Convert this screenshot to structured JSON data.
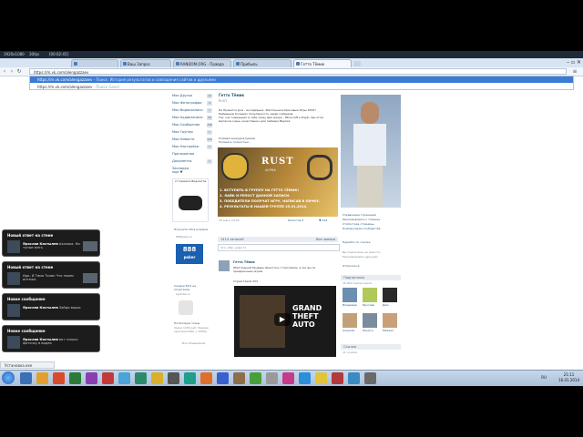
{
  "recording_bar": {
    "items": [
      "1920x1080",
      "30fps",
      "[00:02:45]"
    ]
  },
  "browser": {
    "tabs": [
      {
        "label": ""
      },
      {
        "label": "Ваш Запрос"
      },
      {
        "label": "RANDOM.ORG - Правда"
      },
      {
        "label": "Прибыль"
      },
      {
        "label": "Гетто Тёмик"
      }
    ],
    "address": "https://m.vk.com/alengazzaev",
    "suggestions": [
      {
        "url": "https://m.vk.com/alengazzaev",
        "desc": "- Поиск. История результатов и совпадения сайтов и друзьями"
      },
      {
        "url": "https://m.vk.com/alengazzaev",
        "desc": "- Поиск Gavel"
      }
    ]
  },
  "left_menu": {
    "items": [
      {
        "label": "Мои Друзья",
        "count": "12"
      },
      {
        "label": "Мои Фотографии",
        "count": "4"
      },
      {
        "label": "Мои Видеозаписи",
        "count": "1"
      },
      {
        "label": "Мои Аудиозаписи",
        "count": "35"
      },
      {
        "label": "Мои Сообщения",
        "count": "158"
      },
      {
        "label": "Мои Группы",
        "count": "1"
      },
      {
        "label": "Мои Новости",
        "count": "144"
      },
      {
        "label": "Мои Настройки",
        "count": "1"
      },
      {
        "label": "Приложения",
        "count": ""
      },
      {
        "label": "Документы",
        "count": "1"
      },
      {
        "label": "Закладки",
        "count": ""
      }
    ],
    "extra": "ещё ♥",
    "ad1": {
      "title": "от Сервиса Виджетов",
      "sub": ""
    },
    "ad2": {
      "title": "Получите 1М в игровом",
      "sub": "888poker.ru"
    },
    "ad2_logo": "888",
    "ad2_logo_sub": "poker",
    "ad3": {
      "title": "Скидки 50% на Спортзалы",
      "sub": "sportzal.ru"
    },
    "ad4": {
      "title": "На беговую ткань",
      "sub": "Заказ 1200 руб. Зимние кросовки Nike + 1000р"
    },
    "ad_footer": "Все объявления"
  },
  "profile": {
    "name": "Гетто Тёмик",
    "status": "RUST",
    "bio_lines": [
      "Не Нравится дом - Антидёрьмо, Жёлтенькие Красивые Игры RUST!",
      "Небывшую больших популярность среди геймеров.",
      "Так, как совмещает в себе сразу два жанра - Minecraft и DayZ, при этом",
      "Целиком очень качественно для геймера Версия:"
    ],
    "contest_lines": [
      "Условия конкурса (ниже)",
      "Показать полностью.."
    ],
    "banner": {
      "title": "RUST",
      "subtitle": "ALPHA",
      "rules": [
        "1. ВСТУПИТЬ В ГРУППУ НА ГЕТТО ТЁМИК!",
        "2. ЛАЙК И РЕПОСТ ДАННОЙ ЗАПИСИ.",
        "3. ПОБЕДИТЕЛИ ПОЛУЧАТ ИГРУ, НАПИСАВ В ЛИЧКУ.",
        "4. РЕЗУЛЬТАТЫ В НАШЕЙ ГРУППЕ 25.01.2014."
      ]
    },
    "post_date": "16 янв в 14:02",
    "post_likes": "♥ 144",
    "post_reposts": "Репостов 3",
    "wall_header": "1414 записей",
    "wall_header_right": "Все записи",
    "wall_placeholder": "Что у Вас нового?",
    "post2_author": "Гетто Тёмик",
    "post2_text": "Жёлтенький Рэндарь Красотка с Гангхамом, а лес вы по праздничным играм.",
    "post2_link": "Стрим Такой 333",
    "video_title": "GRAND THEFT AUTO"
  },
  "right_column": {
    "links": [
      "Управление страницей",
      "Рекомендовать к страниц",
      "Статистика страницы",
      "Комментарии сообщества"
    ],
    "links2": [
      "Перейти по ссылке",
      "Вы подписаны на новости",
      "Рекомендовать друзьям"
    ],
    "subscribe": "Отписаться",
    "followers_head": "Подписчики",
    "followers_count": "16 000 подписчиков",
    "followers": [
      {
        "name": "Владимир"
      },
      {
        "name": "Ярослав"
      },
      {
        "name": "Дим"
      },
      {
        "name": "Алексей"
      },
      {
        "name": "Никита"
      },
      {
        "name": "Михаил"
      }
    ],
    "photos_head": "Ссылки",
    "photos_count": "11 ссылка"
  },
  "notifications": [
    {
      "title": "Новый ответ на стене",
      "author": "Ярослав Костылев",
      "text": "Ахахаха. Ни тупые мать"
    },
    {
      "title": "Новый ответ на стене",
      "author": "",
      "text": "Иди. И Тимо Толик Что твоем интеже"
    },
    {
      "title": "Новое сообщение",
      "author": "Ярослав Костылев",
      "text": "Зайди видос"
    },
    {
      "title": "Новое сообщение",
      "author": "Ярослав Костылев",
      "text": "вот только фоточку в видео"
    }
  ],
  "statusbar": "Установка.exe",
  "taskbar": {
    "time": "21:11",
    "date": "16.01.2014",
    "lang": "RU"
  },
  "colors": {
    "vk_blue": "#2b587a",
    "omnibox_selection": "#3a7bd5",
    "notification_bg": "#1c1c1c"
  }
}
